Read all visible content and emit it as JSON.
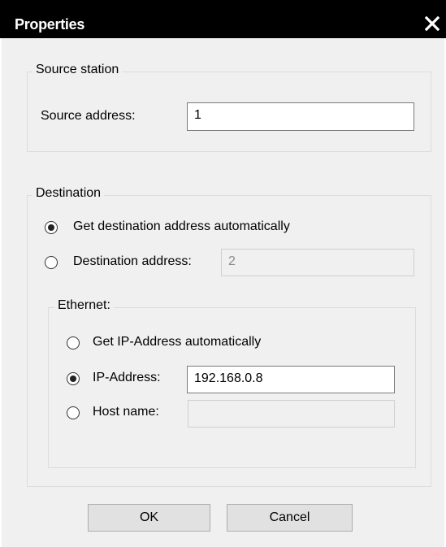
{
  "window": {
    "title": "Properties"
  },
  "source_station": {
    "legend": "Source station",
    "address_label": "Source address:",
    "address_value": "1"
  },
  "destination": {
    "legend": "Destination",
    "auto_label": "Get destination address automatically",
    "auto_selected": true,
    "address_label": "Destination address:",
    "address_value": "2",
    "address_selected": false,
    "ethernet": {
      "legend": "Ethernet:",
      "ip_auto_label": "Get IP-Address automatically",
      "ip_auto_selected": false,
      "ip_label": "IP-Address:",
      "ip_value": "192.168.0.8",
      "ip_selected": true,
      "host_label": "Host name:",
      "host_value": "",
      "host_selected": false
    }
  },
  "buttons": {
    "ok": "OK",
    "cancel": "Cancel"
  },
  "icons": {
    "close": "close-icon"
  }
}
